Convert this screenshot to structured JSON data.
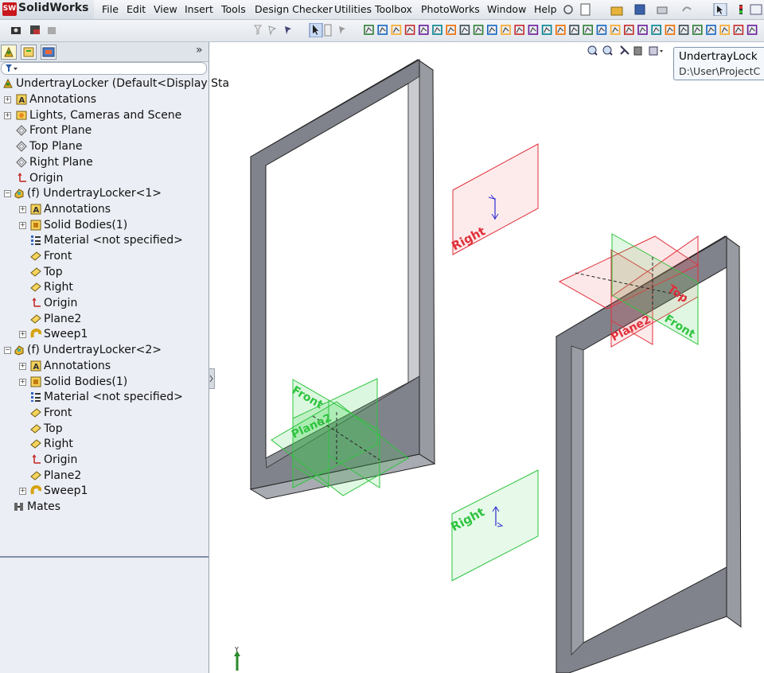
{
  "app": {
    "logo_text": "SolidWorks"
  },
  "menu": [
    "File",
    "Edit",
    "View",
    "Insert",
    "Tools",
    "Design Checker",
    "Utilities",
    "Toolbox",
    "PhotoWorks",
    "Window",
    "Help"
  ],
  "tree": {
    "root": "UndertrayLocker  (Default<Display Sta",
    "items": [
      "Annotations",
      "Lights, Cameras and Scene",
      "Front Plane",
      "Top Plane",
      "Right Plane",
      "Origin",
      "(f) UndertrayLocker<1>",
      "Annotations",
      "Solid Bodies(1)",
      "Material <not specified>",
      "Front",
      "Top",
      "Right",
      "Origin",
      "Plane2",
      "Sweep1",
      "(f) UndertrayLocker<2>",
      "Annotations",
      "Solid Bodies(1)",
      "Material <not specified>",
      "Front",
      "Top",
      "Right",
      "Origin",
      "Plane2",
      "Sweep1",
      "Mates"
    ]
  },
  "tooltip": {
    "title": "UndertrayLock",
    "path": "D:\\User\\ProjectC"
  },
  "viewport": {
    "plane_labels": {
      "right": "Right",
      "front": "Front",
      "top": "Top",
      "plane2": "Plane2"
    },
    "axis_label": "Y"
  },
  "colors": {
    "plane_red": "#e0303a",
    "plane_green": "#2ec43e",
    "frame": "#80838b"
  }
}
